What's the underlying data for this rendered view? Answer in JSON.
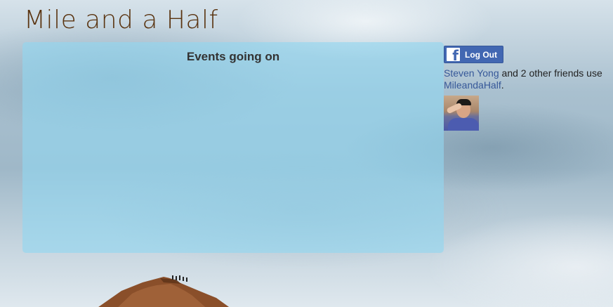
{
  "site": {
    "title": "Mile and a Half"
  },
  "events": {
    "heading": "Events going on"
  },
  "facebook": {
    "button_label": "Log Out",
    "logo_glyph": "f",
    "friend_name": "Steven Yong",
    "friends_text": " and 2 other friends use ",
    "app_name": "MileandaHalf",
    "period": "."
  },
  "colors": {
    "title": "#5a3410",
    "panel": "#91d7f0",
    "facebook_blue": "#4267b2",
    "link": "#365899"
  },
  "icons": {
    "facebook_logo": "facebook-logo-icon"
  }
}
